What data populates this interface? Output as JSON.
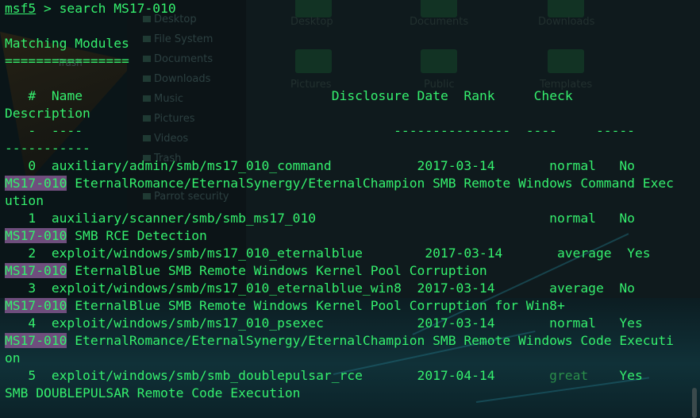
{
  "terminal": {
    "prompt_user": "msf5",
    "prompt_rest": " > search MS17-010",
    "heading": "Matching Modules",
    "heading_rule": "================",
    "columns": {
      "num": "#",
      "name": "Name",
      "date": "Disclosure Date",
      "rank": "Rank",
      "check": "Check",
      "description": "Description"
    },
    "dash_row": "   -  ----                                        ---------------  ----     -----",
    "dash_desc": "-----------",
    "modules": [
      {
        "row": "   0  auxiliary/admin/smb/ms17_010_command           2017-03-14       normal   No",
        "tag": "MS17-010",
        "desc1": " EternalRomance/EternalSynergy/EternalChampion SMB Remote Windows Command Exec",
        "desc2": "ution"
      },
      {
        "row": "   1  auxiliary/scanner/smb/smb_ms17_010                              normal   No",
        "tag": "MS17-010",
        "desc1": " SMB RCE Detection"
      },
      {
        "row": "   2  exploit/windows/smb/ms17_010_eternalblue        2017-03-14       average  Yes",
        "tag": "MS17-010",
        "desc1": " EternalBlue SMB Remote Windows Kernel Pool Corruption"
      },
      {
        "row": "   3  exploit/windows/smb/ms17_010_eternalblue_win8  2017-03-14       average  No",
        "tag": "MS17-010",
        "desc1": " EternalBlue SMB Remote Windows Kernel Pool Corruption for Win8+"
      },
      {
        "row": "   4  exploit/windows/smb/ms17_010_psexec            2017-03-14       normal   Yes",
        "tag": "MS17-010",
        "desc1": " EternalRomance/EternalSynergy/EternalChampion SMB Remote Windows Code Executi",
        "desc2": "on"
      },
      {
        "row_a": "   5  exploit/windows/smb/smb_doublepulsar_rce       2017-04-14       ",
        "rank": "great",
        "row_b": "    Yes",
        "desc1": "SMB DOUBLEPULSAR Remote Code Execution"
      }
    ]
  },
  "background": {
    "trash_label": "Trash",
    "sidebar": [
      "Desktop",
      "File System",
      "Documents",
      "Downloads",
      "Music",
      "Pictures",
      "Videos",
      "Trash",
      "Parrot security"
    ],
    "folders": [
      "Desktop",
      "Documents",
      "Downloads",
      "Pictures",
      "Public",
      "Templates"
    ]
  }
}
